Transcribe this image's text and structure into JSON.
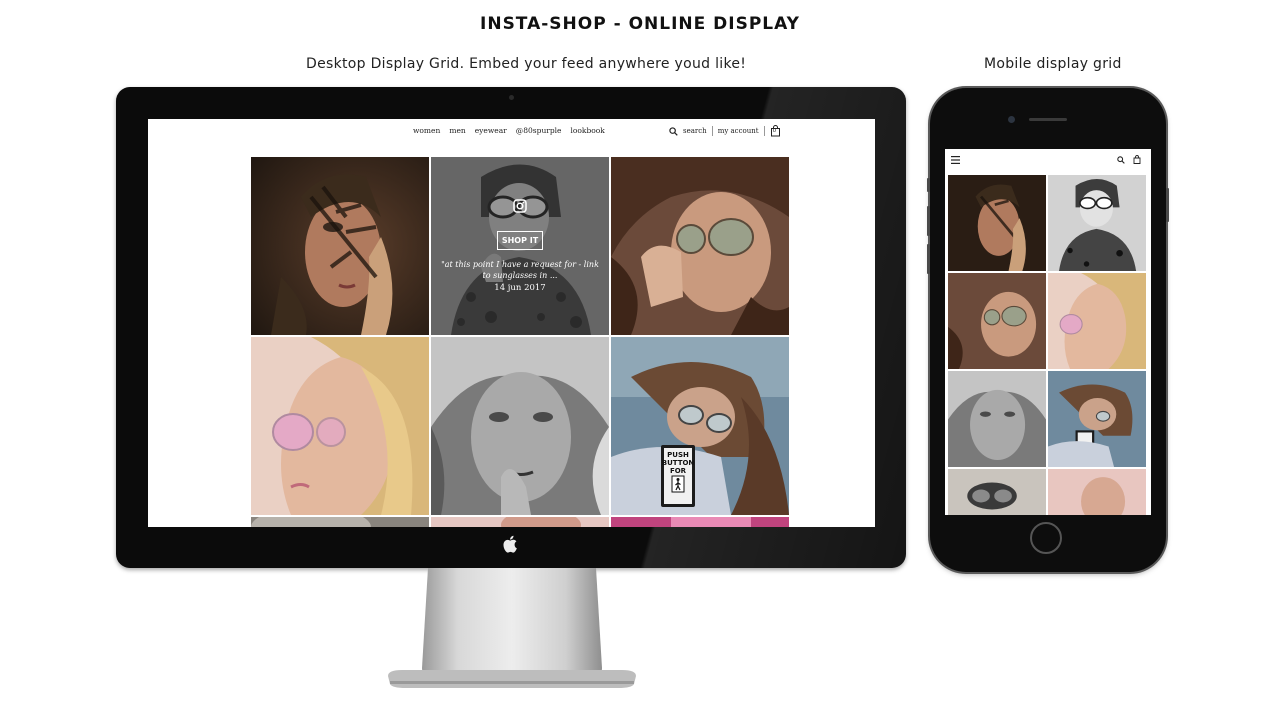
{
  "page": {
    "title": "INSTA-SHOP - ONLINE DISPLAY",
    "desktop_caption": "Desktop Display Grid. Embed your feed anywhere youd like!",
    "mobile_caption": "Mobile display grid"
  },
  "desktop_site": {
    "nav": [
      "women",
      "men",
      "eyewear",
      "@80spurple",
      "lookbook"
    ],
    "search_label": "search",
    "account_label": "my account",
    "cart_count": "0"
  },
  "overlay": {
    "button_label": "SHOP IT",
    "caption": "\"at this point I have a request for - link to sunglasses in ...",
    "date": "14 jun 2017"
  },
  "sign": {
    "lines": [
      "PUSH",
      "BUTTON",
      "FOR"
    ]
  },
  "icons": {
    "search": "search-icon",
    "cart": "cart-icon",
    "instagram": "instagram-icon",
    "menu": "menu-icon",
    "apple": "apple-logo-icon"
  },
  "colors": {
    "bezel": "#0b0b0b",
    "overlay_text": "#ffffff",
    "stand": "#c9c9c9"
  }
}
